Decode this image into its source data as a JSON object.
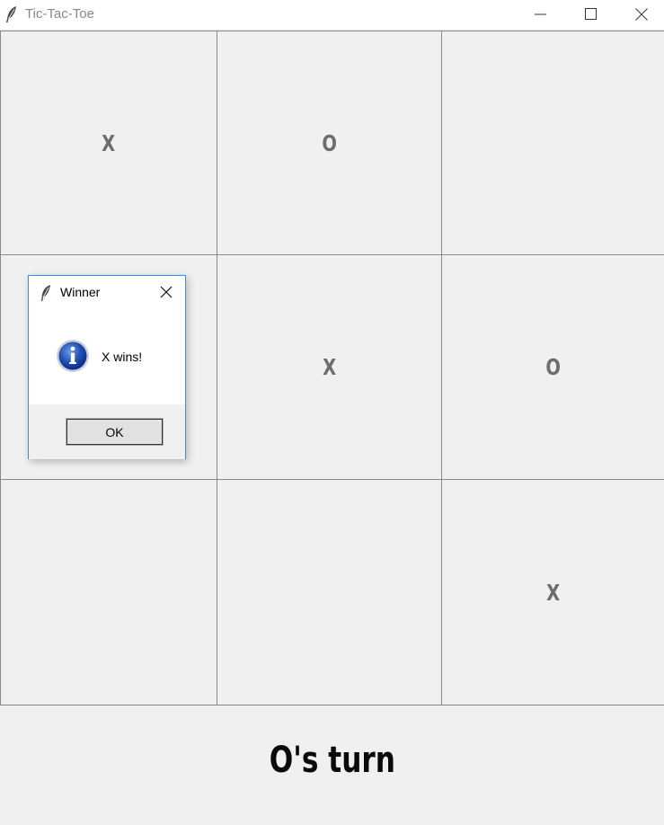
{
  "window": {
    "title": "Tic-Tac-Toe"
  },
  "board": {
    "cells": [
      "X",
      "O",
      "",
      "",
      "X",
      "O",
      "",
      "",
      "X"
    ]
  },
  "status": {
    "text": "O's turn"
  },
  "dialog": {
    "title": "Winner",
    "message": "X wins!",
    "ok_label": "OK",
    "icon": "info-icon"
  },
  "colors": {
    "background": "#f0f0f0",
    "mark": "#6d6d6d",
    "status_text": "#0a0a0a",
    "dialog_border": "#4a8ac2"
  }
}
